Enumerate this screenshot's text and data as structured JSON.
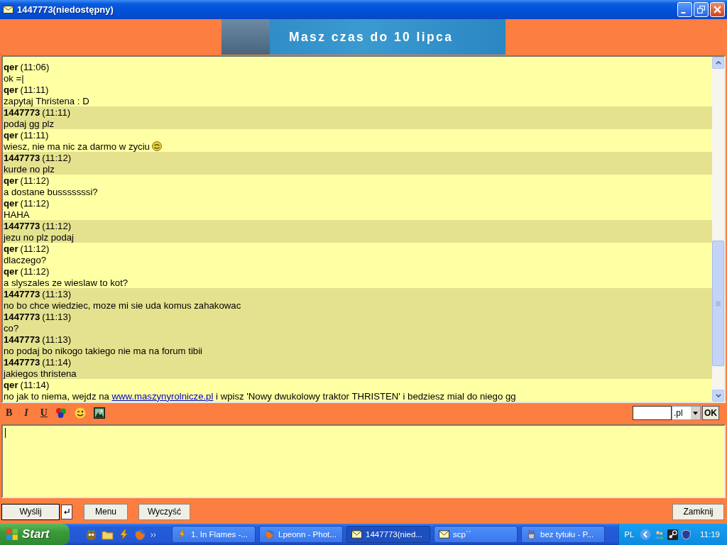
{
  "window": {
    "title": "1447773(niedostępny)"
  },
  "banner": {
    "text": "Masz czas do 10 lipca"
  },
  "messages": [
    {
      "sender": "qer",
      "time": "(11:06)",
      "kind": "outgoing",
      "body": [
        {
          "kind": "text",
          "text": "ok =|"
        }
      ]
    },
    {
      "sender": "qer",
      "time": "(11:11)",
      "kind": "outgoing",
      "body": [
        {
          "kind": "text",
          "text": "zapytaj Thristena : D"
        }
      ]
    },
    {
      "sender": "1447773",
      "time": "(11:11)",
      "kind": "incoming",
      "body": [
        {
          "kind": "text",
          "text": "podaj gg plz"
        }
      ]
    },
    {
      "sender": "qer",
      "time": "(11:11)",
      "kind": "outgoing",
      "body": [
        {
          "kind": "text",
          "text": "wiesz, nie ma nic za darmo w zyciu"
        },
        {
          "kind": "emoticon"
        }
      ]
    },
    {
      "sender": "1447773",
      "time": "(11:12)",
      "kind": "incoming",
      "body": [
        {
          "kind": "text",
          "text": "kurde no plz"
        }
      ]
    },
    {
      "sender": "qer",
      "time": "(11:12)",
      "kind": "outgoing",
      "body": [
        {
          "kind": "text",
          "text": "a dostane busssssssi?"
        }
      ]
    },
    {
      "sender": "qer",
      "time": "(11:12)",
      "kind": "outgoing",
      "body": [
        {
          "kind": "text",
          "text": "HAHA"
        }
      ]
    },
    {
      "sender": "1447773",
      "time": "(11:12)",
      "kind": "incoming",
      "body": [
        {
          "kind": "text",
          "text": "jezu no plz podaj"
        }
      ]
    },
    {
      "sender": "qer",
      "time": "(11:12)",
      "kind": "outgoing",
      "body": [
        {
          "kind": "text",
          "text": "dlaczego?"
        }
      ]
    },
    {
      "sender": "qer",
      "time": "(11:12)",
      "kind": "outgoing",
      "body": [
        {
          "kind": "text",
          "text": "a slyszales ze wieslaw to kot?"
        }
      ]
    },
    {
      "sender": "1447773",
      "time": "(11:13)",
      "kind": "incoming",
      "body": [
        {
          "kind": "text",
          "text": "no bo chce wiedziec, moze mi sie uda komus zahakowac"
        }
      ]
    },
    {
      "sender": "1447773",
      "time": "(11:13)",
      "kind": "incoming",
      "body": [
        {
          "kind": "text",
          "text": "co?"
        }
      ]
    },
    {
      "sender": "1447773",
      "time": "(11:13)",
      "kind": "incoming",
      "body": [
        {
          "kind": "text",
          "text": "no podaj bo nikogo takiego nie ma na forum tibii"
        }
      ]
    },
    {
      "sender": "1447773",
      "time": "(11:14)",
      "kind": "incoming",
      "body": [
        {
          "kind": "text",
          "text": "jakiegos thristena"
        }
      ]
    },
    {
      "sender": "qer",
      "time": "(11:14)",
      "kind": "outgoing",
      "body": [
        {
          "kind": "text",
          "text": "no jak to niema, wejdz na "
        },
        {
          "kind": "link",
          "text": "www.maszynyrolnicze.pl"
        },
        {
          "kind": "text",
          "text": " i wpisz 'Nowy dwukolowy traktor THRISTEN' i bedziesz mial do niego gg"
        }
      ]
    }
  ],
  "toolbar": {
    "items": [
      {
        "kind": "bold",
        "label": "B"
      },
      {
        "kind": "italic",
        "label": "I"
      },
      {
        "kind": "underline",
        "label": "U"
      },
      {
        "kind": "colors"
      },
      {
        "kind": "emoticons"
      },
      {
        "kind": "image"
      }
    ],
    "domain_suffix": ".pl",
    "ok_button": "OK"
  },
  "compose": {
    "focused": true
  },
  "bottom_bar": {
    "send": "Wyślij",
    "menu": "Menu",
    "clear": "Wyczyść",
    "close": "Zamknij"
  },
  "taskbar": {
    "start": "Start",
    "tasks": [
      {
        "label": "1. In Flames -...",
        "kind": "player",
        "selected": false
      },
      {
        "label": "Lpeonn - Phot...",
        "kind": "browser",
        "selected": false
      },
      {
        "label": "1447773(nied...",
        "kind": "messenger",
        "selected": true
      },
      {
        "label": "scp``",
        "kind": "messenger",
        "selected": false
      },
      {
        "label": "bez tytułu - P...",
        "kind": "paint",
        "selected": false
      }
    ],
    "language": "PL",
    "clock": "11:19"
  }
}
